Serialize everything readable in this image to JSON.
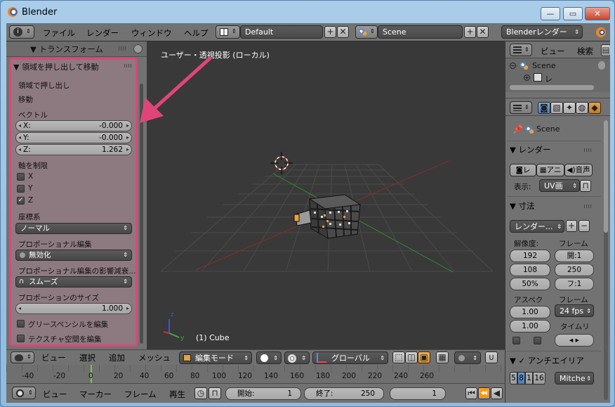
{
  "window": {
    "title": "Blender"
  },
  "top_menu": {
    "items": [
      "ファイル",
      "レンダー",
      "ウィンドウ",
      "ヘルプ"
    ],
    "screen_layout": "Default",
    "scene": "Scene",
    "render_engine": "Blenderレンダー"
  },
  "left_panel": {
    "header": "▼ トランスフォーム",
    "operator_title": "▼ 領域を押し出して移動",
    "op_line1": "領域で押し出し",
    "op_line2": "移動",
    "vector_label": "ベクトル",
    "vector": [
      {
        "axis": "X:",
        "value": "-0.000"
      },
      {
        "axis": "Y:",
        "value": "-0.000"
      },
      {
        "axis": "Z:",
        "value": "1.262"
      }
    ],
    "constraint_label": "軸を制限",
    "axes": [
      {
        "label": "X",
        "checked": false
      },
      {
        "label": "Y",
        "checked": false
      },
      {
        "label": "Z",
        "checked": true
      }
    ],
    "orientation_label": "座標系",
    "orientation_value": "ノーマル",
    "proportional_label": "プロポーショナル編集",
    "proportional_value": "無効化",
    "falloff_label": "プロポーショナル編集の影響減衰...",
    "falloff_value": "スムーズ",
    "size_label": "プロポーションのサイズ",
    "size_value": "1.000",
    "grease_pencil": "グリースペンシルを編集",
    "texture_space": "テクスチャ空間を編集"
  },
  "viewport": {
    "title": "ユーザー・透視投影 (ローカル)",
    "object": "(1) Cube",
    "header": {
      "menus": [
        "ビュー",
        "選択",
        "追加",
        "メッシュ"
      ],
      "mode": "編集モード",
      "orientation": "グローバル"
    }
  },
  "timeline": {
    "ticks": [
      "-40",
      "-20",
      "0",
      "20",
      "40",
      "60",
      "80",
      "100",
      "120",
      "140",
      "160",
      "180",
      "200",
      "220",
      "240",
      "260"
    ],
    "menus": [
      "ビュー",
      "マーカー",
      "フレーム",
      "再生"
    ],
    "start_label": "開始:",
    "start_value": "1",
    "end_label": "終了:",
    "end_value": "250",
    "current": "1"
  },
  "outliner": {
    "menus": [
      "ビュー",
      "検索"
    ],
    "scene_item": "Scene",
    "child_item": "レ"
  },
  "properties": {
    "scene": "Scene",
    "render_section": "▼ レンダー",
    "render_buttons": [
      "レ",
      "アニ",
      "音声"
    ],
    "display_label": "表示:",
    "display_value": "UV画",
    "dimensions_section": "▼ 寸法",
    "preset": "レンダー...",
    "resolution_label": "解像度:",
    "frame_label": "フレーム",
    "res_x": "192",
    "res_y": "108",
    "res_pct": "50%",
    "frame_start": "開:1",
    "frame_end": "250",
    "frame_step": "フ:1",
    "aspect_label": "アスペク",
    "aspect_x": "1.00",
    "aspect_y": "1.00",
    "framerate_label": "フレーム",
    "fps": "24 fps",
    "time_remap": "タイムリ",
    "aa_section": "▼ ✓ アンチエイリア",
    "aa_samples": [
      "5",
      "8",
      "1",
      "16"
    ],
    "aa_filter": "Mitche"
  },
  "colors": {
    "highlight": "#e0457a",
    "panel": "#727272",
    "viewport_bg": "#393939"
  }
}
